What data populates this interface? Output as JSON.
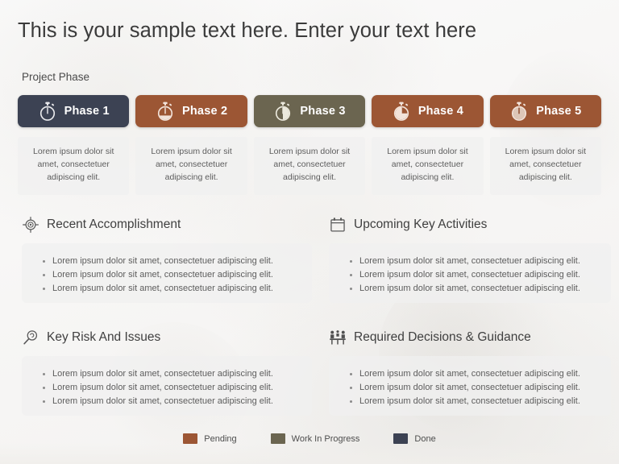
{
  "slide": {
    "title": "This is your sample text here. Enter your text here",
    "section_label": "Project Phase",
    "body_text": "Lorem ipsum dolor sit amet, consectetuer adipiscing elit.",
    "bullet_text": "Lorem ipsum dolor sit amet, consectetuer adipiscing elit."
  },
  "colors": {
    "done": "#3c4253",
    "pending": "#9c5634",
    "work_in_progress": "#6b6550",
    "card_bg": "#f0f0f0",
    "page_bg": "#f7f6f5",
    "title_text": "#3b3b3b",
    "body_text": "#5d5d5d"
  },
  "phases": [
    {
      "label": "Phase 1",
      "icon": "stopwatch-icon",
      "color": "#3c4253",
      "status": "Done",
      "fill": 0,
      "body": "Lorem ipsum dolor sit amet, consectetuer adipiscing elit."
    },
    {
      "label": "Phase 2",
      "icon": "stopwatch-icon",
      "color": "#9c5634",
      "status": "Pending",
      "fill": 40,
      "body": "Lorem ipsum dolor sit amet, consectetuer adipiscing elit."
    },
    {
      "label": "Phase 3",
      "icon": "stopwatch-icon",
      "color": "#6b6550",
      "status": "Work In Progress",
      "fill": 50,
      "body": "Lorem ipsum dolor sit amet, consectetuer adipiscing elit."
    },
    {
      "label": "Phase 4",
      "icon": "stopwatch-icon",
      "color": "#9c5634",
      "status": "Pending",
      "fill": 70,
      "body": "Lorem ipsum dolor sit amet, consectetuer adipiscing elit."
    },
    {
      "label": "Phase 5",
      "icon": "stopwatch-icon",
      "color": "#9c5634",
      "status": "Pending",
      "fill": 90,
      "body": "Lorem ipsum dolor sit amet, consectetuer adipiscing elit."
    }
  ],
  "sections": [
    {
      "title": "Recent Accomplishment",
      "icon": "target-icon",
      "bullets": [
        "Lorem ipsum dolor sit amet, consectetuer adipiscing elit.",
        "Lorem ipsum dolor sit amet, consectetuer adipiscing elit.",
        "Lorem ipsum dolor sit amet, consectetuer adipiscing elit."
      ]
    },
    {
      "title": "Upcoming Key Activities",
      "icon": "calendar-icon",
      "bullets": [
        "Lorem ipsum dolor sit amet, consectetuer adipiscing elit.",
        "Lorem ipsum dolor sit amet, consectetuer adipiscing elit.",
        "Lorem ipsum dolor sit amet, consectetuer adipiscing elit."
      ]
    },
    {
      "title": "Key Risk And Issues",
      "icon": "magnifier-icon",
      "bullets": [
        "Lorem ipsum dolor sit amet, consectetuer adipiscing elit.",
        "Lorem ipsum dolor sit amet, consectetuer adipiscing elit.",
        "Lorem ipsum dolor sit amet, consectetuer adipiscing elit."
      ]
    },
    {
      "title": "Required Decisions & Guidance",
      "icon": "meeting-icon",
      "bullets": [
        "Lorem ipsum dolor sit amet, consectetuer adipiscing elit.",
        "Lorem ipsum dolor sit amet, consectetuer adipiscing elit.",
        "Lorem ipsum dolor sit amet, consectetuer adipiscing elit."
      ]
    }
  ],
  "legend": [
    {
      "label": "Pending",
      "color": "#9c5634"
    },
    {
      "label": "Work In Progress",
      "color": "#6b6550"
    },
    {
      "label": "Done",
      "color": "#3c4253"
    }
  ]
}
